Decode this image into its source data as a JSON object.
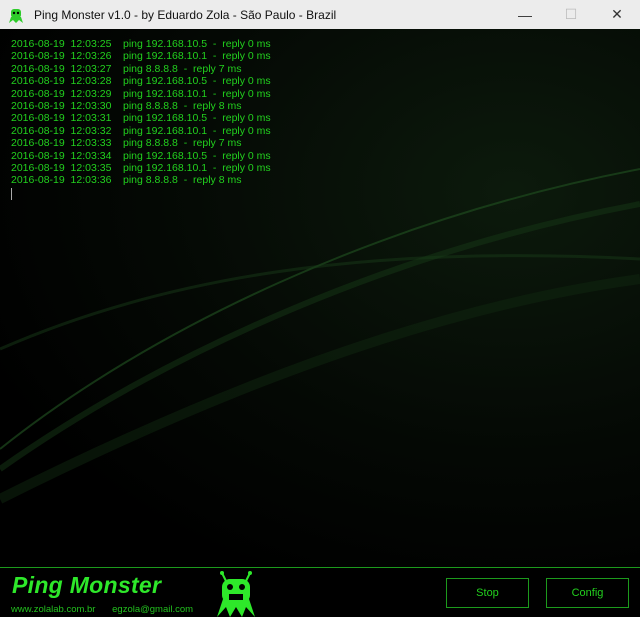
{
  "window": {
    "title": "Ping Monster v1.0  -  by Eduardo Zola  - São Paulo - Brazil",
    "minimize": "—",
    "maximize": "☐",
    "close": "✕"
  },
  "log": [
    {
      "ts": "2016-08-19  12:03:25",
      "msg": "ping 192.168.10.5  -  reply 0 ms"
    },
    {
      "ts": "2016-08-19  12:03:26",
      "msg": "ping 192.168.10.1  -  reply 0 ms"
    },
    {
      "ts": "2016-08-19  12:03:27",
      "msg": "ping 8.8.8.8  -  reply 7 ms"
    },
    {
      "ts": "2016-08-19  12:03:28",
      "msg": "ping 192.168.10.5  -  reply 0 ms"
    },
    {
      "ts": "2016-08-19  12:03:29",
      "msg": "ping 192.168.10.1  -  reply 0 ms"
    },
    {
      "ts": "2016-08-19  12:03:30",
      "msg": "ping 8.8.8.8  -  reply 8 ms"
    },
    {
      "ts": "2016-08-19  12:03:31",
      "msg": "ping 192.168.10.5  -  reply 0 ms"
    },
    {
      "ts": "2016-08-19  12:03:32",
      "msg": "ping 192.168.10.1  -  reply 0 ms"
    },
    {
      "ts": "2016-08-19  12:03:33",
      "msg": "ping 8.8.8.8  -  reply 7 ms"
    },
    {
      "ts": "2016-08-19  12:03:34",
      "msg": "ping 192.168.10.5  -  reply 0 ms"
    },
    {
      "ts": "2016-08-19  12:03:35",
      "msg": "ping 192.168.10.1  -  reply 0 ms"
    },
    {
      "ts": "2016-08-19  12:03:36",
      "msg": "ping 8.8.8.8  -  reply 8 ms"
    }
  ],
  "footer": {
    "brand": "Ping Monster",
    "website": "www.zolalab.com.br",
    "email": "egzola@gmail.com",
    "stop_label": "Stop",
    "config_label": "Config"
  },
  "colors": {
    "accent": "#22d01e"
  }
}
